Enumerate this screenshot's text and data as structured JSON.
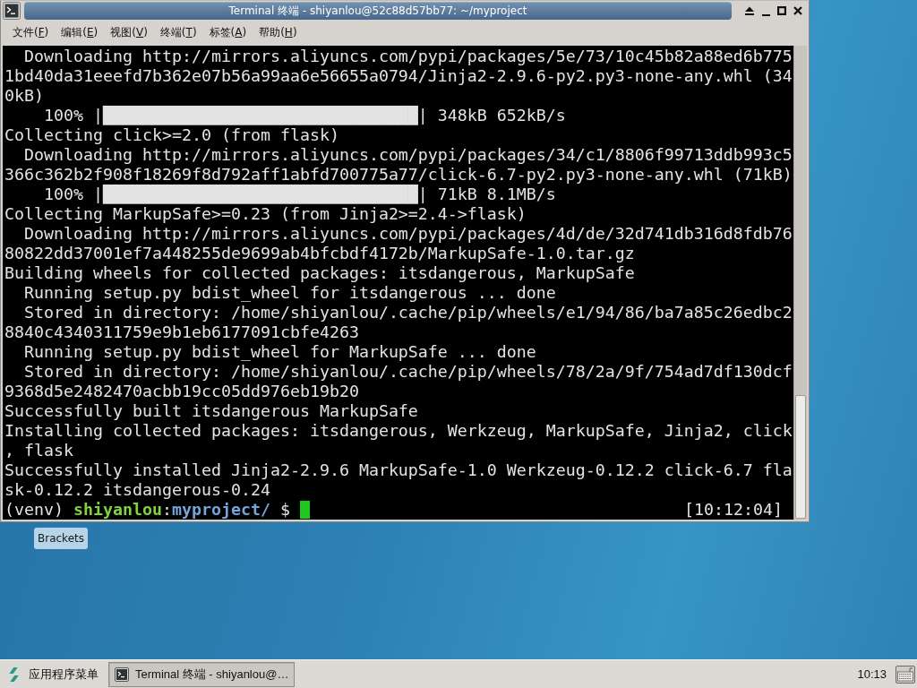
{
  "window": {
    "title": "Terminal 终端 - shiyanlou@52c88d57bb77: ~/myproject",
    "menu": [
      {
        "before": "文件(",
        "mnemonic": "F",
        "after": ")"
      },
      {
        "before": "编辑(",
        "mnemonic": "E",
        "after": ")"
      },
      {
        "before": "视图(",
        "mnemonic": "V",
        "after": ")"
      },
      {
        "before": "终端(",
        "mnemonic": "T",
        "after": ")"
      },
      {
        "before": "标签(",
        "mnemonic": "A",
        "after": ")"
      },
      {
        "before": "帮助(",
        "mnemonic": "H",
        "after": ")"
      }
    ]
  },
  "terminal": {
    "lines": [
      "  Downloading http://mirrors.aliyuncs.com/pypi/packages/5e/73/10c45b82a88ed6b775",
      "1bd40da31eeefd7b362e07b56a99aa6e56655a0794/Jinja2-2.9.6-py2.py3-none-any.whl (34",
      "0kB)",
      "    100% |████████████████████████████████| 348kB 652kB/s",
      "Collecting click>=2.0 (from flask)",
      "  Downloading http://mirrors.aliyuncs.com/pypi/packages/34/c1/8806f99713ddb993c5",
      "366c362b2f908f18269f8d792aff1abfd700775a77/click-6.7-py2.py3-none-any.whl (71kB)",
      "    100% |████████████████████████████████| 71kB 8.1MB/s",
      "Collecting MarkupSafe>=0.23 (from Jinja2>=2.4->flask)",
      "  Downloading http://mirrors.aliyuncs.com/pypi/packages/4d/de/32d741db316d8fdb76",
      "80822dd37001ef7a448255de9699ab4bfcbdf4172b/MarkupSafe-1.0.tar.gz",
      "Building wheels for collected packages: itsdangerous, MarkupSafe",
      "  Running setup.py bdist_wheel for itsdangerous ... done",
      "  Stored in directory: /home/shiyanlou/.cache/pip/wheels/e1/94/86/ba7a85c26edbc2",
      "8840c4340311759e9b1eb6177091cbfe4263",
      "  Running setup.py bdist_wheel for MarkupSafe ... done",
      "  Stored in directory: /home/shiyanlou/.cache/pip/wheels/78/2a/9f/754ad7df130dcf",
      "9368d5e2482470acbb19cc05dd976eb19b20",
      "Successfully built itsdangerous MarkupSafe",
      "Installing collected packages: itsdangerous, Werkzeug, MarkupSafe, Jinja2, click",
      ", flask",
      "Successfully installed Jinja2-2.9.6 MarkupSafe-1.0 Werkzeug-0.12.2 click-6.7 fla",
      "sk-0.12.2 itsdangerous-0.24"
    ],
    "prompt": {
      "env": "(venv)",
      "user": "shiyanlou",
      "separator": ":",
      "path": "myproject/",
      "symbol": "$",
      "time": "[10:12:04]"
    }
  },
  "desktop": {
    "icons": [
      {
        "label": "Brackets"
      }
    ]
  },
  "taskbar": {
    "app_menu": "应用程序菜单",
    "tasks": [
      {
        "title": "Terminal 终端 - shiyanlou@…",
        "selected": true
      }
    ],
    "clock": "10:13"
  }
}
